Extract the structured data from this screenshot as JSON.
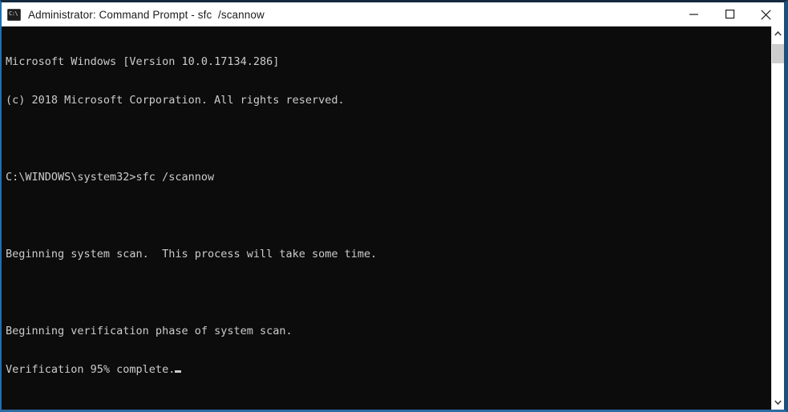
{
  "window": {
    "title": "Administrator: Command Prompt - sfc  /scannow",
    "icon": "console-icon",
    "icon_glyph": "C:\\",
    "accent_border_color": "#2b6ca3",
    "titlebar_background": "#ffffff",
    "titlebar_text_color": "#1c1c1c"
  },
  "controls": {
    "minimize_label": "Minimize",
    "maximize_label": "Maximize",
    "close_label": "Close"
  },
  "console": {
    "background_color": "#0c0c0c",
    "text_color": "#cccccc",
    "lines": [
      "Microsoft Windows [Version 10.0.17134.286]",
      "(c) 2018 Microsoft Corporation. All rights reserved.",
      "",
      "C:\\WINDOWS\\system32>sfc /scannow",
      "",
      "Beginning system scan.  This process will take some time.",
      "",
      "Beginning verification phase of system scan.",
      "Verification 95% complete."
    ],
    "cursor_visible": true,
    "progress_percent": 95,
    "os_version": "10.0.17134.286",
    "copyright_year": "2018",
    "prompt_path": "C:\\WINDOWS\\system32",
    "command": "sfc /scannow"
  },
  "scrollbar": {
    "up_arrow": "chevron-up-icon",
    "down_arrow": "chevron-down-icon",
    "thumb_color": "#cdcdcd",
    "track_color": "#ffffff"
  }
}
